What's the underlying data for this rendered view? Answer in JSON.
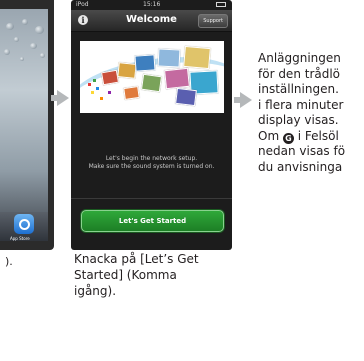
{
  "left_panel": {
    "dock_label": "App Store",
    "caption_fragment": ")."
  },
  "phone": {
    "status_carrier": "iPod",
    "status_time": "15:16",
    "title": "Welcome",
    "support_label": "Support",
    "info_label": "i",
    "setup_text_line1": "Let's begin the network setup.",
    "setup_text_line2": "Make sure the sound system is turned on.",
    "start_button_label": "Let's Get Started"
  },
  "caption": {
    "line1": "Knacka på [Let’s Get",
    "line2": "Started] (Komma",
    "line3": "igång)."
  },
  "right_text": {
    "line1": "Anläggningen",
    "line2": "för den trådlö",
    "line3": "inställningen.",
    "line4": "i flera minuter",
    "line5": "display visas.",
    "line6_before": "Om ",
    "badge": "G",
    "line6_after": " i Felsöl",
    "line7": "nedan visas fö",
    "line8": "du anvisninga"
  },
  "colors": {
    "start_button": "#239b2f",
    "arrow": "#b5b8ba"
  }
}
